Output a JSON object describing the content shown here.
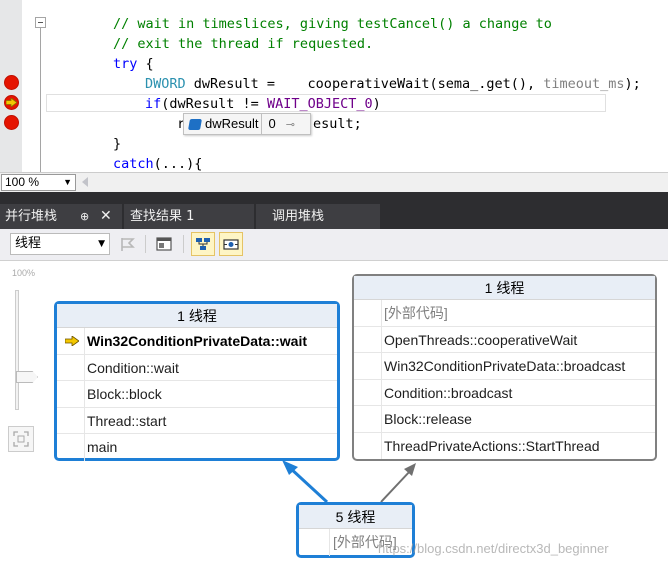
{
  "editor": {
    "lines": [
      {
        "comment": "// wait in timeslices, giving testCancel() a change to"
      },
      {
        "comment": "// exit the thread if requested."
      },
      {
        "kw": "try",
        "rest": " {"
      },
      {
        "type": "DWORD",
        "rest": " dwResult =    cooperativeWait(sema_.get(), ",
        "param": "timeout_ms",
        "tail": ");"
      },
      {
        "kw": "if",
        "rest": "(dwResult != ",
        "macro": "WAIT_OBJECT_0",
        "tail": ")"
      },
      {
        "pre": "r",
        "post": "esult;"
      },
      {
        "rest": "}"
      },
      {
        "kw": "catch",
        "rest": "(...){"
      }
    ],
    "datatip": {
      "name": "dwResult",
      "value": "0",
      "icon": "variable-cube-icon"
    }
  },
  "zoom": {
    "value": "100 %"
  },
  "tabs": [
    {
      "label": "并行堆栈",
      "pin": "⊕",
      "close": "✕"
    },
    {
      "label": "查找结果 1"
    },
    {
      "label": "调用堆栈"
    }
  ],
  "toolbar": {
    "view_value": "线程"
  },
  "canvas": {
    "zoom_percent": "100%",
    "stacks": [
      {
        "id": "stack1",
        "header": "1 线程",
        "frames": [
          {
            "text": "Win32ConditionPrivateData::wait",
            "current": true
          },
          {
            "text": "Condition::wait"
          },
          {
            "text": "Block::block"
          },
          {
            "text": "Thread::start"
          },
          {
            "text": "main"
          }
        ]
      },
      {
        "id": "stack2",
        "header": "1 线程",
        "frames": [
          {
            "text": "[外部代码]",
            "external": true
          },
          {
            "text": "OpenThreads::cooperativeWait"
          },
          {
            "text": "Win32ConditionPrivateData::broadcast"
          },
          {
            "text": "Condition::broadcast"
          },
          {
            "text": "Block::release"
          },
          {
            "text": "ThreadPrivateActions::StartThread"
          }
        ]
      },
      {
        "id": "stack3",
        "header": "5 线程",
        "frames": [
          {
            "text": "[外部代码]",
            "external": true
          }
        ]
      }
    ],
    "watermark": "https://blog.csdn.net/directx3d_beginner"
  },
  "colors": {
    "selected_border": "#1e7fd6",
    "stack_border": "#808080",
    "breakpoint": "#e51400",
    "current_arrow": "#f3c700",
    "comment": "#008000",
    "keyword": "#0000ff",
    "type": "#2b91af",
    "macro": "#6f008a",
    "tab_bar": "#2d2d30"
  }
}
